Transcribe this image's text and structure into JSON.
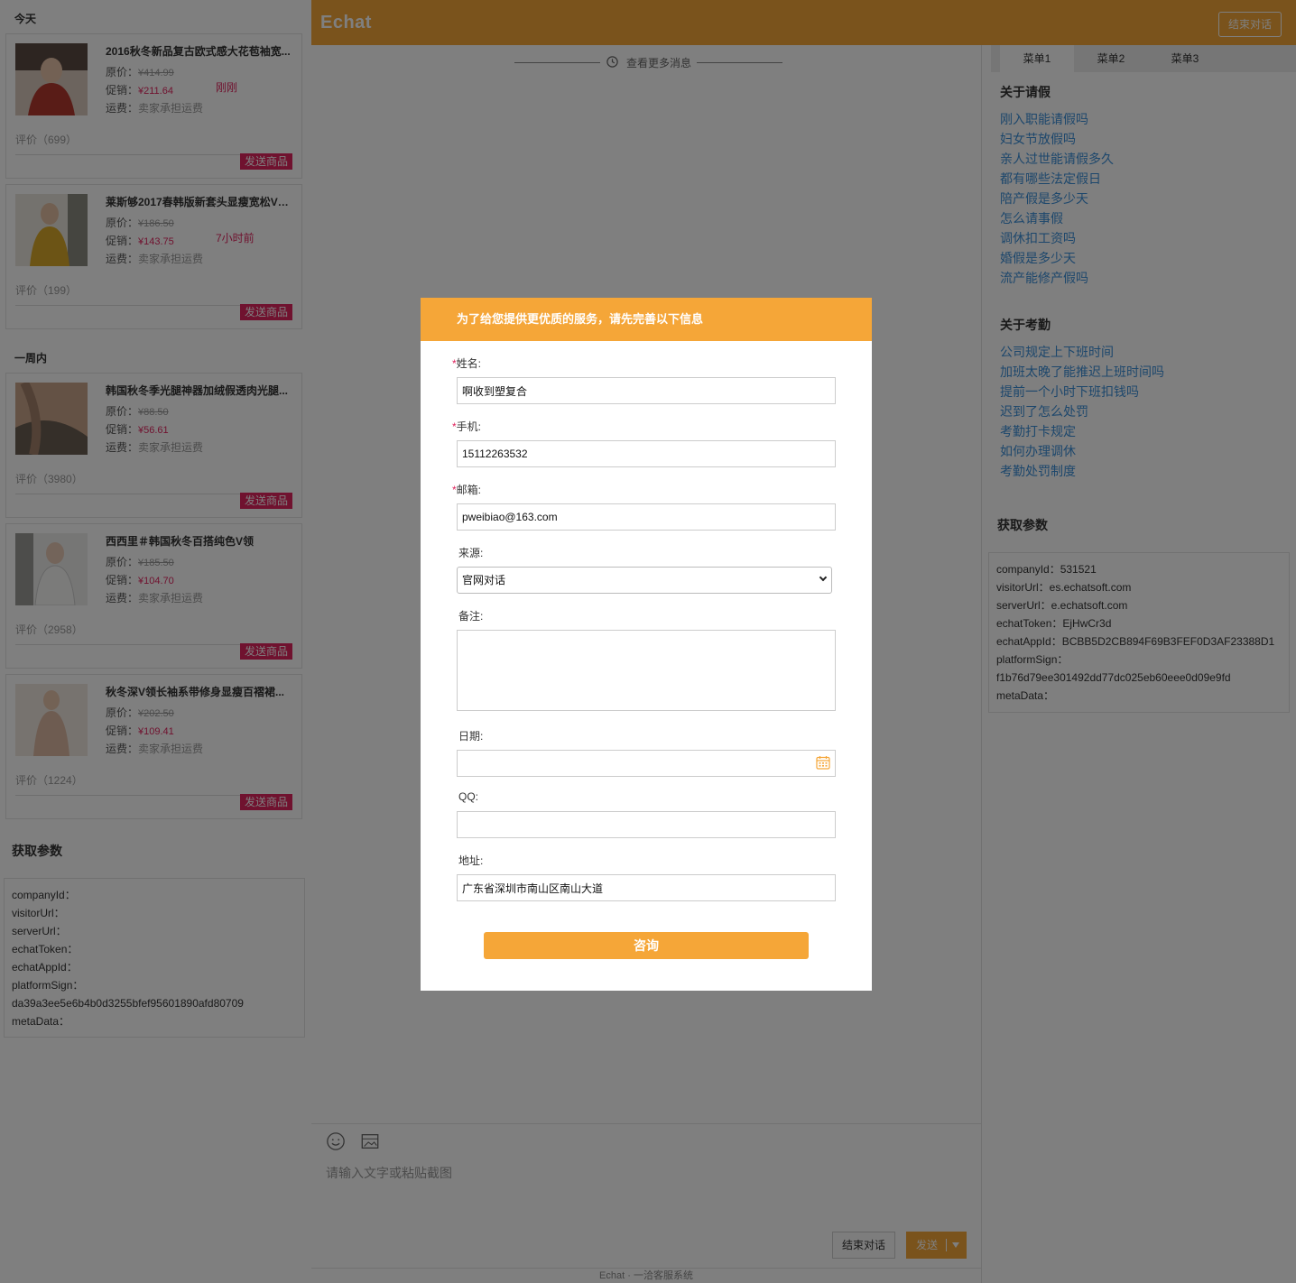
{
  "left": {
    "today_label": "今天",
    "week_label": "一周内",
    "price_label": "原价：",
    "promo_label": "促销：",
    "ship_label": "运费：",
    "send_label": "发送商品",
    "products": [
      {
        "name": "2016秋冬新品复古欧式感大花苞袖宽...",
        "orig": "¥414.99",
        "promo": "¥211.64",
        "ship": "卖家承担运费",
        "time": "刚刚",
        "rating": "评价（699）"
      },
      {
        "name": "莱斯够2017春韩版新套头显瘦宽松V领...",
        "orig": "¥186.50",
        "promo": "¥143.75",
        "ship": "卖家承担运费",
        "time": "7小时前",
        "rating": "评价（199）"
      },
      {
        "name": "韩国秋冬季光腿神器加绒假透肉光腿...",
        "orig": "¥88.50",
        "promo": "¥56.61",
        "ship": "卖家承担运费",
        "time": "",
        "rating": "评价（3980）"
      },
      {
        "name": "西西里＃韩国秋冬百搭纯色V领",
        "orig": "¥185.50",
        "promo": "¥104.70",
        "ship": "卖家承担运费",
        "time": "",
        "rating": "评价（2958）"
      },
      {
        "name": "秋冬深V领长袖系带修身显瘦百褶裙...",
        "orig": "¥202.50",
        "promo": "¥109.41",
        "ship": "卖家承担运费",
        "time": "",
        "rating": "评价（1224）"
      }
    ],
    "params_title": "获取参数",
    "params": [
      "companyId：",
      "visitorUrl：",
      "serverUrl：",
      "echatToken：",
      "echatAppId：",
      "platformSign：",
      "da39a3ee5e6b4b0d3255bfef95601890afd80709",
      "metaData："
    ]
  },
  "topbar": {
    "logo": "Echat",
    "end_button": "结束对话"
  },
  "chat": {
    "more_messages": "查看更多消息",
    "input_placeholder": "请输入文字或粘贴截图",
    "end_button": "结束对话",
    "send_button": "发送",
    "footer": "Echat · 一洽客服系统"
  },
  "right": {
    "tabs": [
      "菜单1",
      "菜单2",
      "菜单3"
    ],
    "faq_groups": [
      {
        "title": "关于请假",
        "items": [
          "刚入职能请假吗",
          "妇女节放假吗",
          "亲人过世能请假多久",
          "都有哪些法定假日",
          "陪产假是多少天",
          "怎么请事假",
          "调休扣工资吗",
          "婚假是多少天",
          "流产能修产假吗"
        ]
      },
      {
        "title": "关于考勤",
        "items": [
          "公司规定上下班时间",
          "加班太晚了能推迟上班时间吗",
          "提前一个小时下班扣钱吗",
          "迟到了怎么处罚",
          "考勤打卡规定",
          "如何办理调休",
          "考勤处罚制度"
        ]
      }
    ],
    "params_title": "获取参数",
    "params": [
      "companyId：531521",
      "visitorUrl：es.echatsoft.com",
      "serverUrl：e.echatsoft.com",
      "echatToken：EjHwCr3d",
      "echatAppId：BCBB5D2CB894F69B3FEF0D3AF23388D1",
      "platformSign：",
      "f1b76d79ee301492dd77dc025eb60eee0d09e9fd",
      "metaData："
    ]
  },
  "modal": {
    "title": "为了给您提供更优质的服务，请先完善以下信息",
    "required_mark": "*",
    "name_label": "姓名:",
    "name_value": "啊收到塑复合",
    "phone_label": "手机:",
    "phone_value": "15112263532",
    "email_label": "邮箱:",
    "email_value": "pweibiao@163.com",
    "source_label": "来源:",
    "source_value": "官网对话",
    "remark_label": "备注:",
    "date_label": "日期:",
    "qq_label": "QQ:",
    "address_label": "地址:",
    "address_value": "广东省深圳市南山区南山大道",
    "submit": "咨询"
  },
  "colors": {
    "brand": "#f5a638",
    "promo": "#e0245e",
    "link": "#3b8fd9",
    "overlay": "rgba(0,0,0,0.5)"
  },
  "icons": [
    "history-icon",
    "emoji-icon",
    "image-icon",
    "calendar-icon",
    "chevron-down-icon"
  ]
}
